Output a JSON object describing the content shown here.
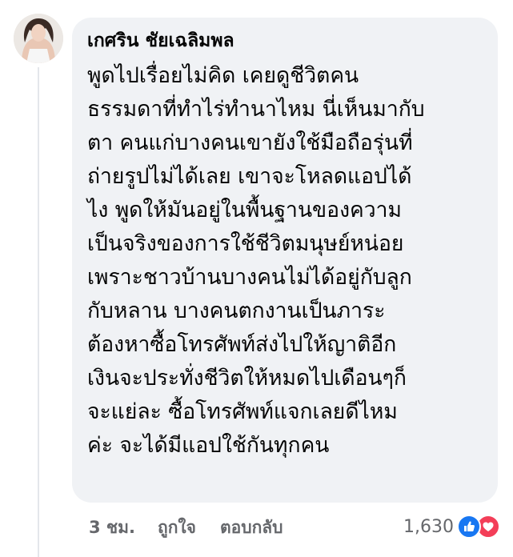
{
  "comment": {
    "author": "เกศริน ชัยเฉลิมพล",
    "lines": [
      "พูดไปเรื่อยไม่คิด เคยดูชีวิตคน",
      "ธรรมดาที่ทำไร่ทำนาไหม นี่เห็นมากับ",
      "ตา คนแก่บางคนเขายังใช้มือถือรุ่นที่",
      "ถ่ายรูปไม่ได้เลย เขาจะโหลดแอปได้",
      "ไง พูดให้มันอยู่ในพื้นฐานของความ",
      "เป็นจริงของการใช้ชีวิตมนุษย์หน่อย",
      "เพราะชาวบ้านบางคนไม่ได้อยู่กับลูก",
      "กับหลาน บางคนตกงานเป็นภาระ",
      "ต้องหาซื้อโทรศัพท์ส่งไปให้ญาติอีก",
      "เงินจะประทั่งชีวิตให้หมดไปเดือนๆก็",
      "จะแย่ละ ซื้อโทรศัพท์แจกเลยดีไหม",
      "ค่ะ จะได้มีแอปใช้กันทุกคน"
    ]
  },
  "actions": {
    "time": "3 ชม.",
    "like_label": "ถูกใจ",
    "reply_label": "ตอบกลับ"
  },
  "reactions": {
    "count": "1,630",
    "icons": [
      "like-reaction-icon",
      "love-reaction-icon"
    ],
    "colors": {
      "like": "#1877f2",
      "love": "#f33e58"
    }
  },
  "colors": {
    "bubble": "#f0f2f5",
    "text": "#050505",
    "secondary": "#65676b"
  }
}
